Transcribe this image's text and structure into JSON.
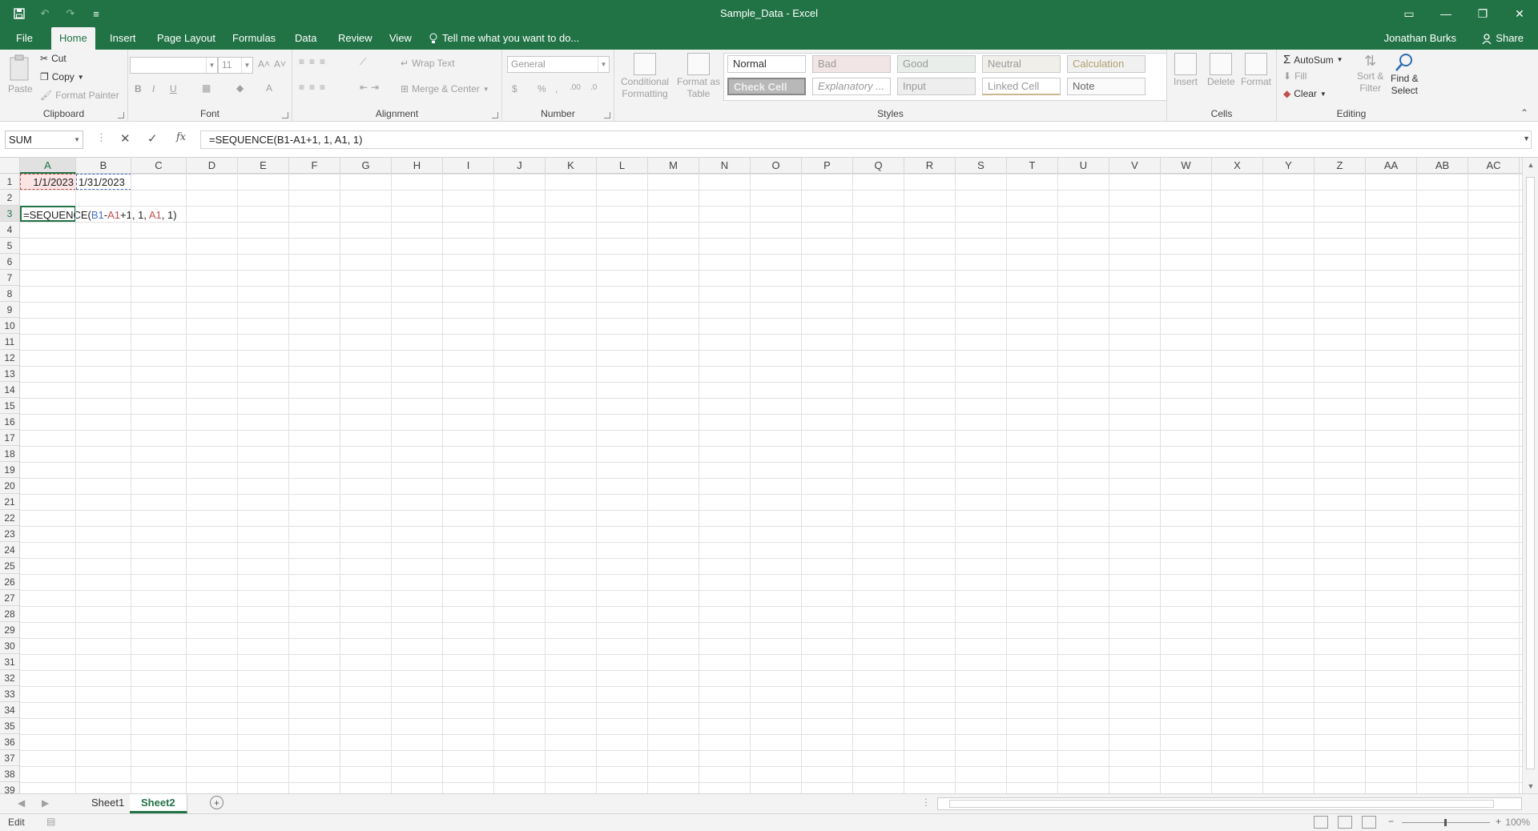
{
  "window": {
    "title": "Sample_Data - Excel",
    "qat": {
      "save": "💾",
      "undo": "↶",
      "redo": "↷",
      "customize": "≡"
    },
    "controls": {
      "ribbon_opts": "▭",
      "minimize": "—",
      "restore": "❐",
      "close": "✕"
    }
  },
  "tabs": {
    "file": "File",
    "home": "Home",
    "insert": "Insert",
    "page_layout": "Page Layout",
    "formulas": "Formulas",
    "data": "Data",
    "review": "Review",
    "view": "View",
    "tell_me": "Tell me what you want to do...",
    "user": "Jonathan Burks",
    "share": "Share"
  },
  "ribbon": {
    "clipboard": {
      "label": "Clipboard",
      "paste": "Paste",
      "cut": "Cut",
      "copy": "Copy",
      "format_painter": "Format Painter"
    },
    "font": {
      "label": "Font",
      "font_size": "11",
      "bold": "B",
      "italic": "I",
      "underline": "U",
      "grow": "A˄",
      "shrink": "A˅",
      "font_color": "A",
      "fill": "◆",
      "borders": "▦"
    },
    "alignment": {
      "label": "Alignment",
      "wrap": "Wrap Text",
      "merge": "Merge & Center"
    },
    "number": {
      "label": "Number",
      "format": "General",
      "currency": "$",
      "percent": "%",
      "comma": ",",
      "inc_dec": ".00",
      "dec_dec": ".0"
    },
    "styles": {
      "label": "Styles",
      "conditional": "Conditional",
      "conditional2": "Formatting",
      "format_table": "Format as",
      "format_table2": "Table",
      "normal": "Normal",
      "bad": "Bad",
      "good": "Good",
      "neutral": "Neutral",
      "calculation": "Calculation",
      "check_cell": "Check Cell",
      "explanatory": "Explanatory ...",
      "input": "Input",
      "linked_cell": "Linked Cell",
      "note": "Note"
    },
    "cells": {
      "label": "Cells",
      "insert": "Insert",
      "delete": "Delete",
      "format": "Format"
    },
    "editing": {
      "label": "Editing",
      "autosum": "AutoSum",
      "fill": "Fill",
      "clear": "Clear",
      "sort1": "Sort &",
      "sort2": "Filter",
      "find1": "Find &",
      "find2": "Select"
    }
  },
  "formula_bar": {
    "name_box": "SUM",
    "cancel": "✕",
    "enter": "✓",
    "fx": "fx",
    "content": "=SEQUENCE(B1-A1+1, 1, A1, 1)"
  },
  "grid": {
    "columns": [
      "A",
      "B",
      "C",
      "D",
      "E",
      "F",
      "G",
      "H",
      "I",
      "J",
      "K",
      "L",
      "M",
      "N",
      "O",
      "P",
      "Q",
      "R",
      "S",
      "T",
      "U",
      "V",
      "W",
      "X",
      "Y",
      "Z",
      "AA",
      "AB",
      "AC"
    ],
    "rows": [
      "1",
      "2",
      "3",
      "4",
      "5",
      "6",
      "7",
      "8",
      "9",
      "10",
      "11",
      "12",
      "13",
      "14",
      "15",
      "16",
      "17",
      "18",
      "19",
      "20",
      "21",
      "22",
      "23",
      "24",
      "25",
      "26",
      "27",
      "28",
      "29",
      "30",
      "31",
      "32",
      "33",
      "34",
      "35",
      "36",
      "37",
      "38",
      "39"
    ],
    "a1": "1/1/2023",
    "b1": "1/31/2023",
    "a3": {
      "p1": "=SEQUENCE(",
      "p2": "B1",
      "p3": "-",
      "p4": "A1",
      "p5": "+1, 1, ",
      "p6": "A1",
      "p7": ", 1)"
    }
  },
  "sheets": {
    "sheet1": "Sheet1",
    "sheet2": "Sheet2",
    "add": "+"
  },
  "status": {
    "mode": "Edit",
    "zoom": "100%"
  },
  "colors": {
    "accent": "#217346",
    "ref_blue": "#4472c4",
    "ref_red": "#c0504d"
  }
}
